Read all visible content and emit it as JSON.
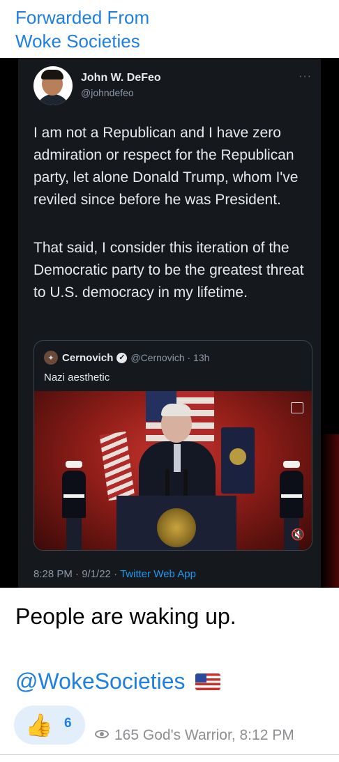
{
  "forward": {
    "label": "Forwarded From",
    "source": "Woke Societies"
  },
  "tweet": {
    "author_name": "John W. DeFeo",
    "author_handle": "@johndefeo",
    "more": "···",
    "paragraph1": "I am not a Republican and I have zero admiration or respect for the Republican party, let alone Donald Trump, whom I've reviled since before he was President.",
    "paragraph2": "That said, I consider this iteration of the Democratic party to be the greatest threat to U.S. democracy in my lifetime.",
    "quote": {
      "author_name": "Cernovich",
      "verified_mark": "✓",
      "handle_time": "@Cernovich · 13h",
      "text": "Nazi aesthetic"
    },
    "footer_time": "8:28 PM · 9/1/22 · ",
    "footer_app": "Twitter Web App"
  },
  "caption": "People are waking up.",
  "link_text": "@WokeSocieties",
  "reaction": {
    "emoji": "👍",
    "count": "6"
  },
  "meta": {
    "views": "165",
    "author": "God's Warrior,",
    "time": "8:12 PM"
  },
  "icons": [
    "thumbs-up-icon",
    "eye-icon",
    "us-flag-icon",
    "pip-icon",
    "mute-icon",
    "verified-icon"
  ],
  "colors": {
    "link": "#1f7fe0",
    "tweet_bg": "#15181c",
    "tweet_text": "#e7e9ea",
    "muted": "#8e8e93",
    "twitter_blue": "#1d9bf0"
  }
}
